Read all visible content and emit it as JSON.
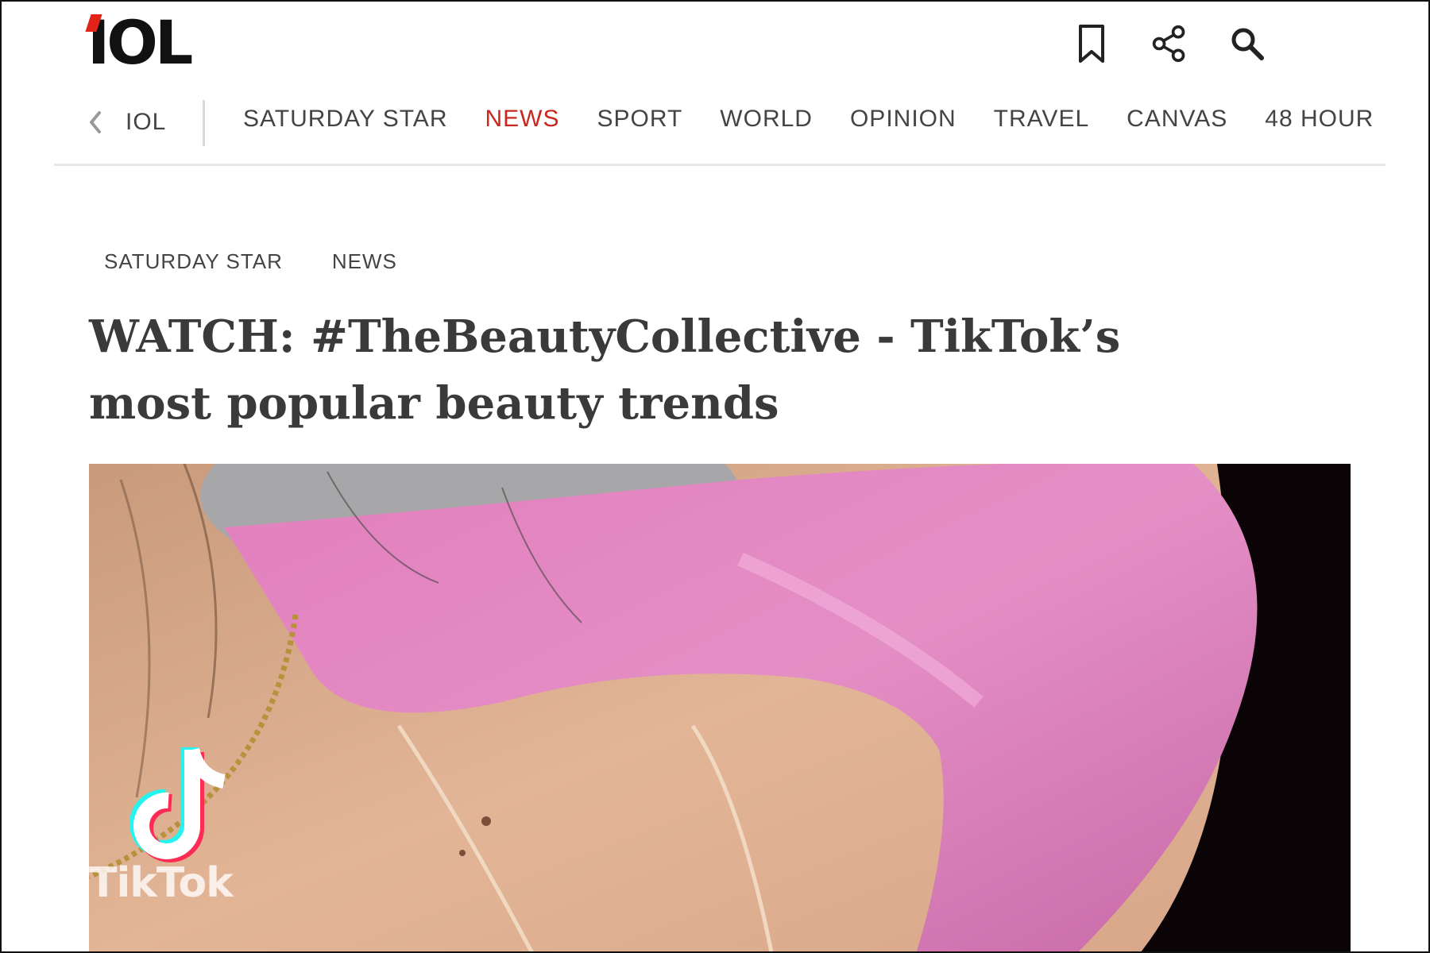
{
  "header": {
    "logo_text": "IOL",
    "icons": [
      "bookmark-icon",
      "share-icon",
      "search-icon"
    ],
    "brand_color": "#e2231a"
  },
  "nav": {
    "home_label": "IOL",
    "items": [
      {
        "label": "SATURDAY STAR",
        "active": false
      },
      {
        "label": "NEWS",
        "active": true
      },
      {
        "label": "SPORT",
        "active": false
      },
      {
        "label": "WORLD",
        "active": false
      },
      {
        "label": "OPINION",
        "active": false
      },
      {
        "label": "TRAVEL",
        "active": false
      },
      {
        "label": "CANVAS",
        "active": false
      },
      {
        "label": "48 HOUR",
        "active": false
      }
    ],
    "active_color": "#c8281d"
  },
  "article": {
    "categories": [
      "SATURDAY STAR",
      "NEWS"
    ],
    "headline": "WATCH: #TheBeautyCollective - TikTok’s most popular beauty trends",
    "hero_watermark": "TikTok"
  }
}
